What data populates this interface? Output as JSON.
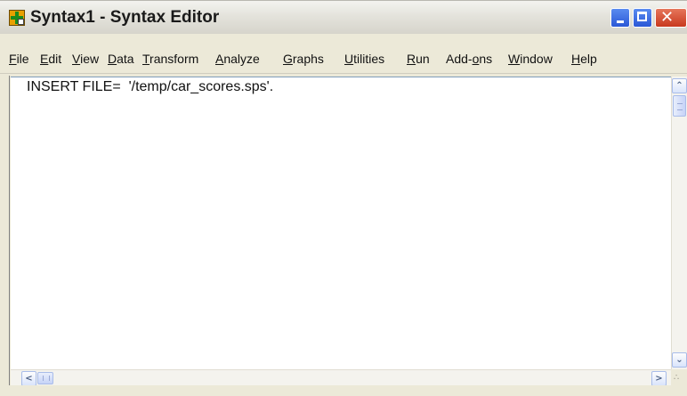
{
  "window": {
    "title": "Syntax1 - Syntax Editor",
    "close_glyph": "✕"
  },
  "menu": [
    {
      "label": "File",
      "u": "F",
      "rest": "ile"
    },
    {
      "label": "Edit",
      "u": "E",
      "rest": "dit"
    },
    {
      "label": "View",
      "u": "V",
      "rest": "iew"
    },
    {
      "label": "Data",
      "u": "D",
      "rest": "ata"
    },
    {
      "label": "Transform",
      "u": "T",
      "rest": "ransform"
    },
    {
      "label": "Analyze",
      "u": "A",
      "rest": "nalyze"
    },
    {
      "label": "Graphs",
      "u": "G",
      "rest": "raphs"
    },
    {
      "label": "Utilities",
      "u": "U",
      "rest": "tilities"
    },
    {
      "label": "Run",
      "u": "R",
      "rest": "un"
    },
    {
      "label": "Add-ons",
      "pre": "Add-",
      "u": "o",
      "rest": "ns"
    },
    {
      "label": "Window",
      "u": "W",
      "rest": "indow"
    },
    {
      "label": "Help",
      "u": "H",
      "rest": "elp"
    }
  ],
  "editor": {
    "content": "INSERT FILE=  '/temp/car_scores.sps'."
  },
  "scrollbars": {
    "up_glyph": "⌃",
    "down_glyph": "⌄",
    "left_glyph": "<",
    "right_glyph": ">"
  },
  "colors": {
    "window_bg": "#ece9d8",
    "editor_bg": "#ffffff",
    "close_button": "#c8391f",
    "title_button": "#2b58d6"
  }
}
